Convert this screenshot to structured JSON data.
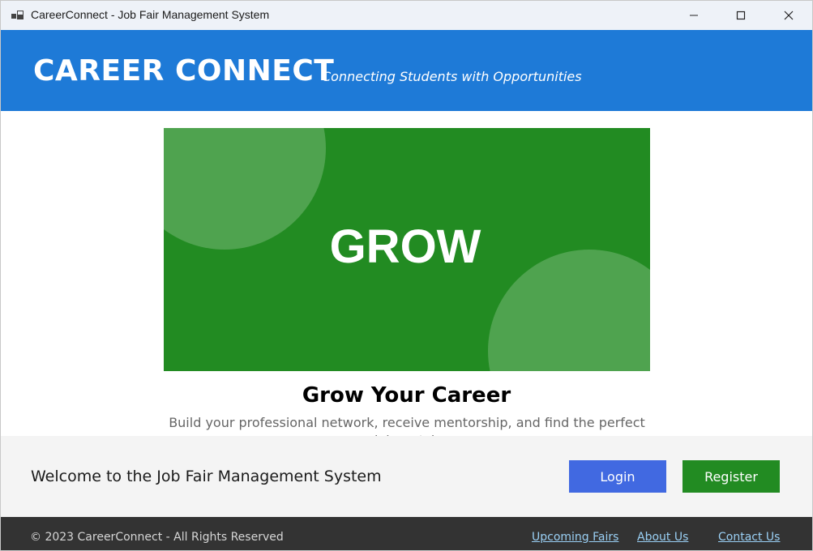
{
  "window": {
    "title": "CareerConnect - Job Fair Management System",
    "app_icon": "app-window-icon",
    "controls": [
      "minimize-icon",
      "maximize-icon",
      "close-icon"
    ]
  },
  "header": {
    "brand": "CAREER CONNECT",
    "tagline": "Connecting Students with Opportunities",
    "background_color": "#1e7ad7"
  },
  "slide": {
    "banner_word": "GROW",
    "banner_color": "#228b22",
    "accent_circle_color": "#4fa34f",
    "title": "Grow Your Career",
    "description": "Build your professional network, receive mentorship, and find the perfect job match"
  },
  "action_bar": {
    "welcome": "Welcome to the Job Fair Management System",
    "login_label": "Login",
    "register_label": "Register",
    "login_color": "#4169e1",
    "register_color": "#228b22"
  },
  "footer": {
    "copyright": "© 2023 CareerConnect - All Rights Reserved",
    "links": [
      "Upcoming Fairs",
      "About Us",
      "Contact Us"
    ],
    "background_color": "#333333"
  }
}
